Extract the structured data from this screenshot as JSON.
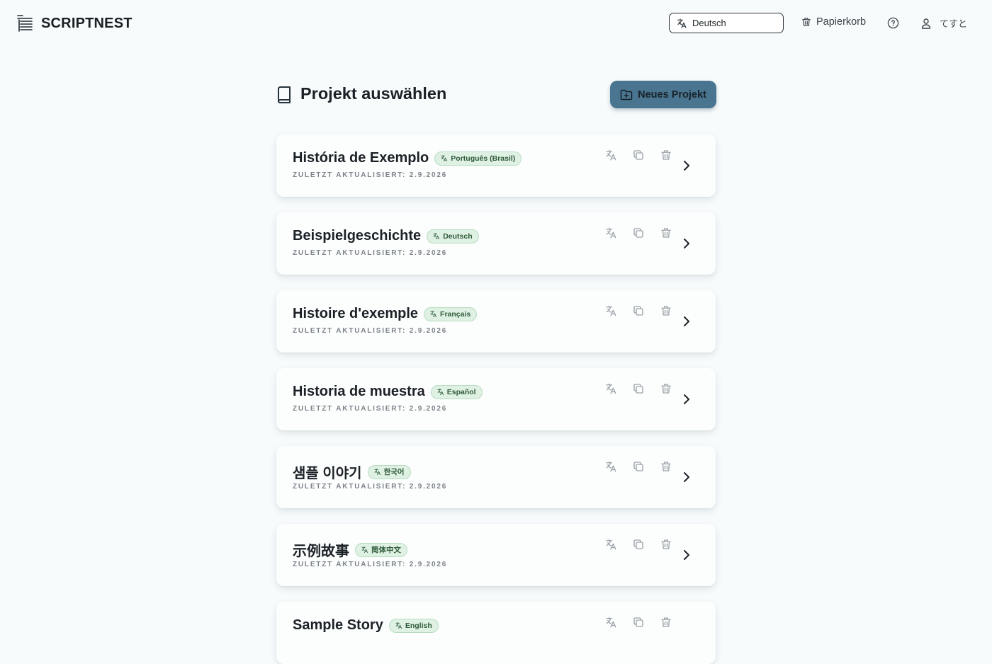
{
  "app": {
    "name": "SCRIPTNEST"
  },
  "header": {
    "language_select": {
      "value": "Deutsch",
      "icon": "translate-icon"
    },
    "trash_label": "Papierkorb",
    "help_icon": "help-circle-icon",
    "user_name": "てすと"
  },
  "main": {
    "title": "Projekt auswählen",
    "new_project_label": "Neues Projekt"
  },
  "projects": [
    {
      "title": "História de Exemplo",
      "language": "Português (Brasil)",
      "updated": "ZULETZT AKTUALISIERT: 2.9.2026"
    },
    {
      "title": "Beispielgeschichte",
      "language": "Deutsch",
      "updated": "ZULETZT AKTUALISIERT: 2.9.2026"
    },
    {
      "title": "Histoire d'exemple",
      "language": "Français",
      "updated": "ZULETZT AKTUALISIERT: 2.9.2026"
    },
    {
      "title": "Historia de muestra",
      "language": "Español",
      "updated": "ZULETZT AKTUALISIERT: 2.9.2026"
    },
    {
      "title": "샘플 이야기",
      "language": "한국어",
      "updated": "ZULETZT AKTUALISIERT: 2.9.2026"
    },
    {
      "title": "示例故事",
      "language": "简体中文",
      "updated": "ZULETZT AKTUALISIERT: 2.9.2026"
    },
    {
      "title": "Sample Story",
      "language": "English",
      "updated": ""
    }
  ],
  "colors": {
    "background": "#f7fbfc",
    "primary_button": "#4a7590",
    "badge_bg": "#dff1e3",
    "badge_text": "#2e5a3a"
  }
}
